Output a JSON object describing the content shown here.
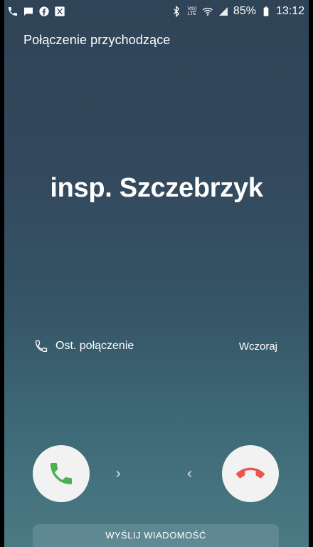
{
  "status_bar": {
    "left_icons": [
      "phone-icon",
      "message-icon",
      "facebook-icon",
      "app-icon"
    ],
    "right_icons": [
      "bluetooth-icon",
      "volte-icon",
      "wifi-icon",
      "signal-icon",
      "battery-icon"
    ],
    "volte_label": "Vo)) LTE",
    "battery": "85%",
    "time": "13:12"
  },
  "incoming_call": {
    "header": "Połączenie przychodzące",
    "caller_name": "insp. Szczebrzyk",
    "last_call_label": "Ost. połączenie",
    "last_call_date": "Wczoraj"
  },
  "actions": {
    "accept_icon": "phone-accept-icon",
    "decline_icon": "phone-decline-icon",
    "accept_color": "#4caf50",
    "decline_color": "#e8564f",
    "send_message_label": "WYŚLIJ WIADOMOŚĆ"
  }
}
